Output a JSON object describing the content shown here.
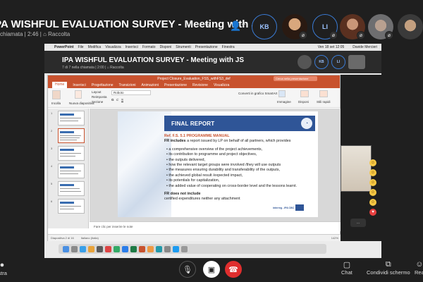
{
  "call": {
    "title": "IPA WISHFUL EVALUATION SURVEY - Meeting with JS",
    "subtitle": "chiamata | 2:46 | ⌂ Raccolta",
    "participants": [
      "KB",
      "LI"
    ]
  },
  "mac_menu": {
    "items": [
      "PowerPoint",
      "File",
      "Modifica",
      "Visualizza",
      "Inserisci",
      "Formato",
      "Disponi",
      "Strumenti",
      "Presentazione",
      "Finestra"
    ],
    "clock": "Ven 18 set 12:05",
    "user": "Davide Mercieri"
  },
  "inner_call": {
    "title": "IPA WISHFUL EVALUATION SURVEY - Meeting with JS",
    "subtitle": "7 di 7 nella chiamata | 2:00 | ⌂ Raccolta",
    "participants": [
      "KB",
      "LI"
    ]
  },
  "ppt": {
    "window_title": "Project Closure_Evaluation_FSS_withFS3_def",
    "search_placeholder": "Cerca nella presentazione",
    "tabs": [
      "Home",
      "Inserisci",
      "Progettazione",
      "Transizioni",
      "Animazioni",
      "Presentazione",
      "Revisione",
      "Visualizza"
    ],
    "ribbon": {
      "paste": "Incolla",
      "layout": "Layout",
      "reset": "Reimposta",
      "new_slide": "Nuova diapositiva",
      "section": "Sezione",
      "font": "Roboto",
      "arrange": "Disponi",
      "quick_styles": "Stili rapidi",
      "convert_smartart": "Converti in grafico SmartArt",
      "image": "Immagine"
    },
    "slide": {
      "heading": "FINAL REPORT",
      "ref": "Ref. F.S. 5.1 PROGRAMME MANUAL",
      "intro_bold": "FR includes",
      "intro_rest": "a report issued by LP on behalf of all partners, which provides",
      "bullets": [
        "a comprehensive overview of the project achievements,",
        "its contribution to programme and project objectives,",
        "the outputs delivered,",
        "how the relevant target groups were involved /they will use outputs",
        "the measures ensuring durability and transferability of the outputs,",
        "the achieved global result /expected impact,",
        "its potentials for capitalization,",
        "the added value of cooperating on cross-border level and the lessons learnt."
      ],
      "exclude_bold": "FR does not include",
      "exclude_rest": "certified expenditures neither any attachment",
      "logo_text": "interreg - IPA CBC"
    },
    "notes_placeholder": "Fare clic per inserire le note",
    "status_left": "Diapositiva 2 di 16",
    "status_lang": "Italiano (Italia)",
    "status_zoom": "142%"
  },
  "controls": {
    "record": "Registra",
    "chat": "Chat",
    "share": "Condividi schermo",
    "react": "Rea"
  }
}
